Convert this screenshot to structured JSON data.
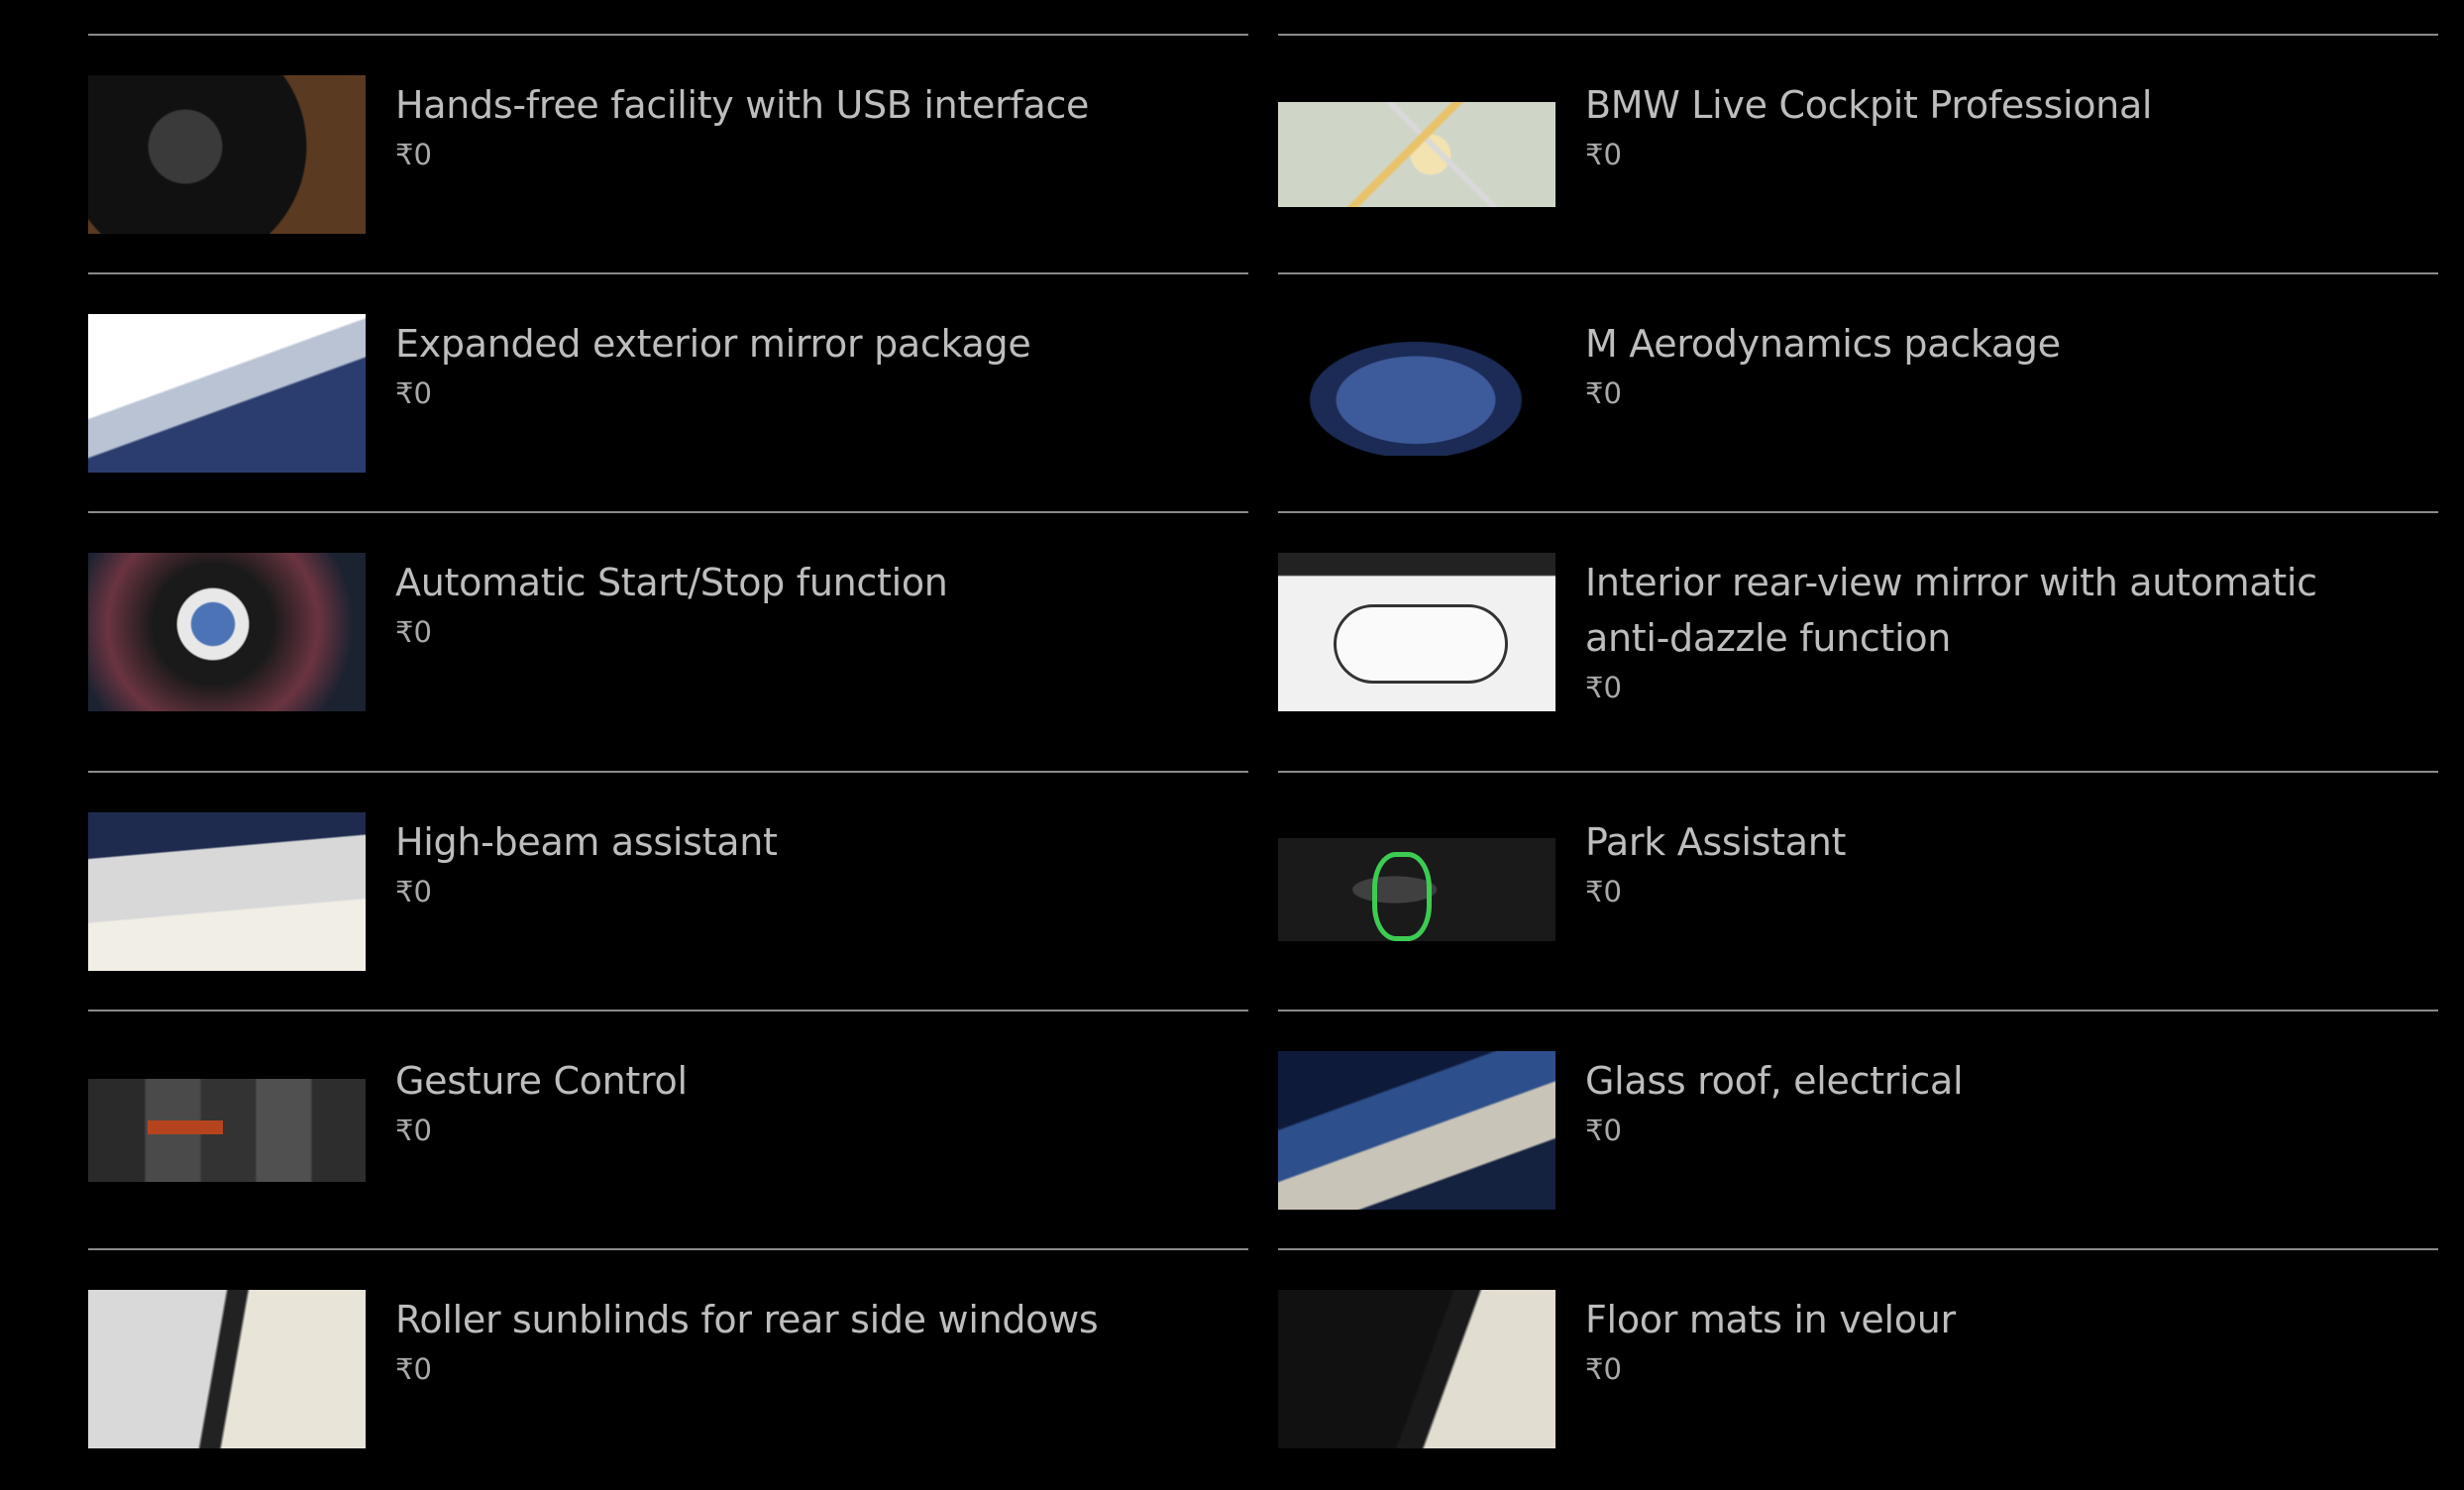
{
  "options": [
    {
      "title": "Hands-free facility with USB interface",
      "price": "₹0",
      "icon": "steering-wheel-image"
    },
    {
      "title": "BMW Live Cockpit Professional",
      "price": "₹0",
      "icon": "navigation-map-image"
    },
    {
      "title": "Expanded exterior mirror package",
      "price": "₹0",
      "icon": "exterior-mirror-image"
    },
    {
      "title": "M Aerodynamics package",
      "price": "₹0",
      "icon": "car-exterior-image"
    },
    {
      "title": "Automatic Start/Stop function",
      "price": "₹0",
      "icon": "bmw-logo-image"
    },
    {
      "title": "Interior rear-view mirror with automatic anti-dazzle function",
      "price": "₹0",
      "icon": "rear-view-mirror-image"
    },
    {
      "title": "High-beam assistant",
      "price": "₹0",
      "icon": "windshield-camera-image"
    },
    {
      "title": "Park Assistant",
      "price": "₹0",
      "icon": "parking-display-image"
    },
    {
      "title": "Gesture Control",
      "price": "₹0",
      "icon": "infotainment-screen-image"
    },
    {
      "title": "Glass roof, electrical",
      "price": "₹0",
      "icon": "sunroof-image"
    },
    {
      "title": "Roller sunblinds for rear side windows",
      "price": "₹0",
      "icon": "rear-sunblind-image"
    },
    {
      "title": "Floor mats in velour",
      "price": "₹0",
      "icon": "floor-mats-image"
    }
  ]
}
